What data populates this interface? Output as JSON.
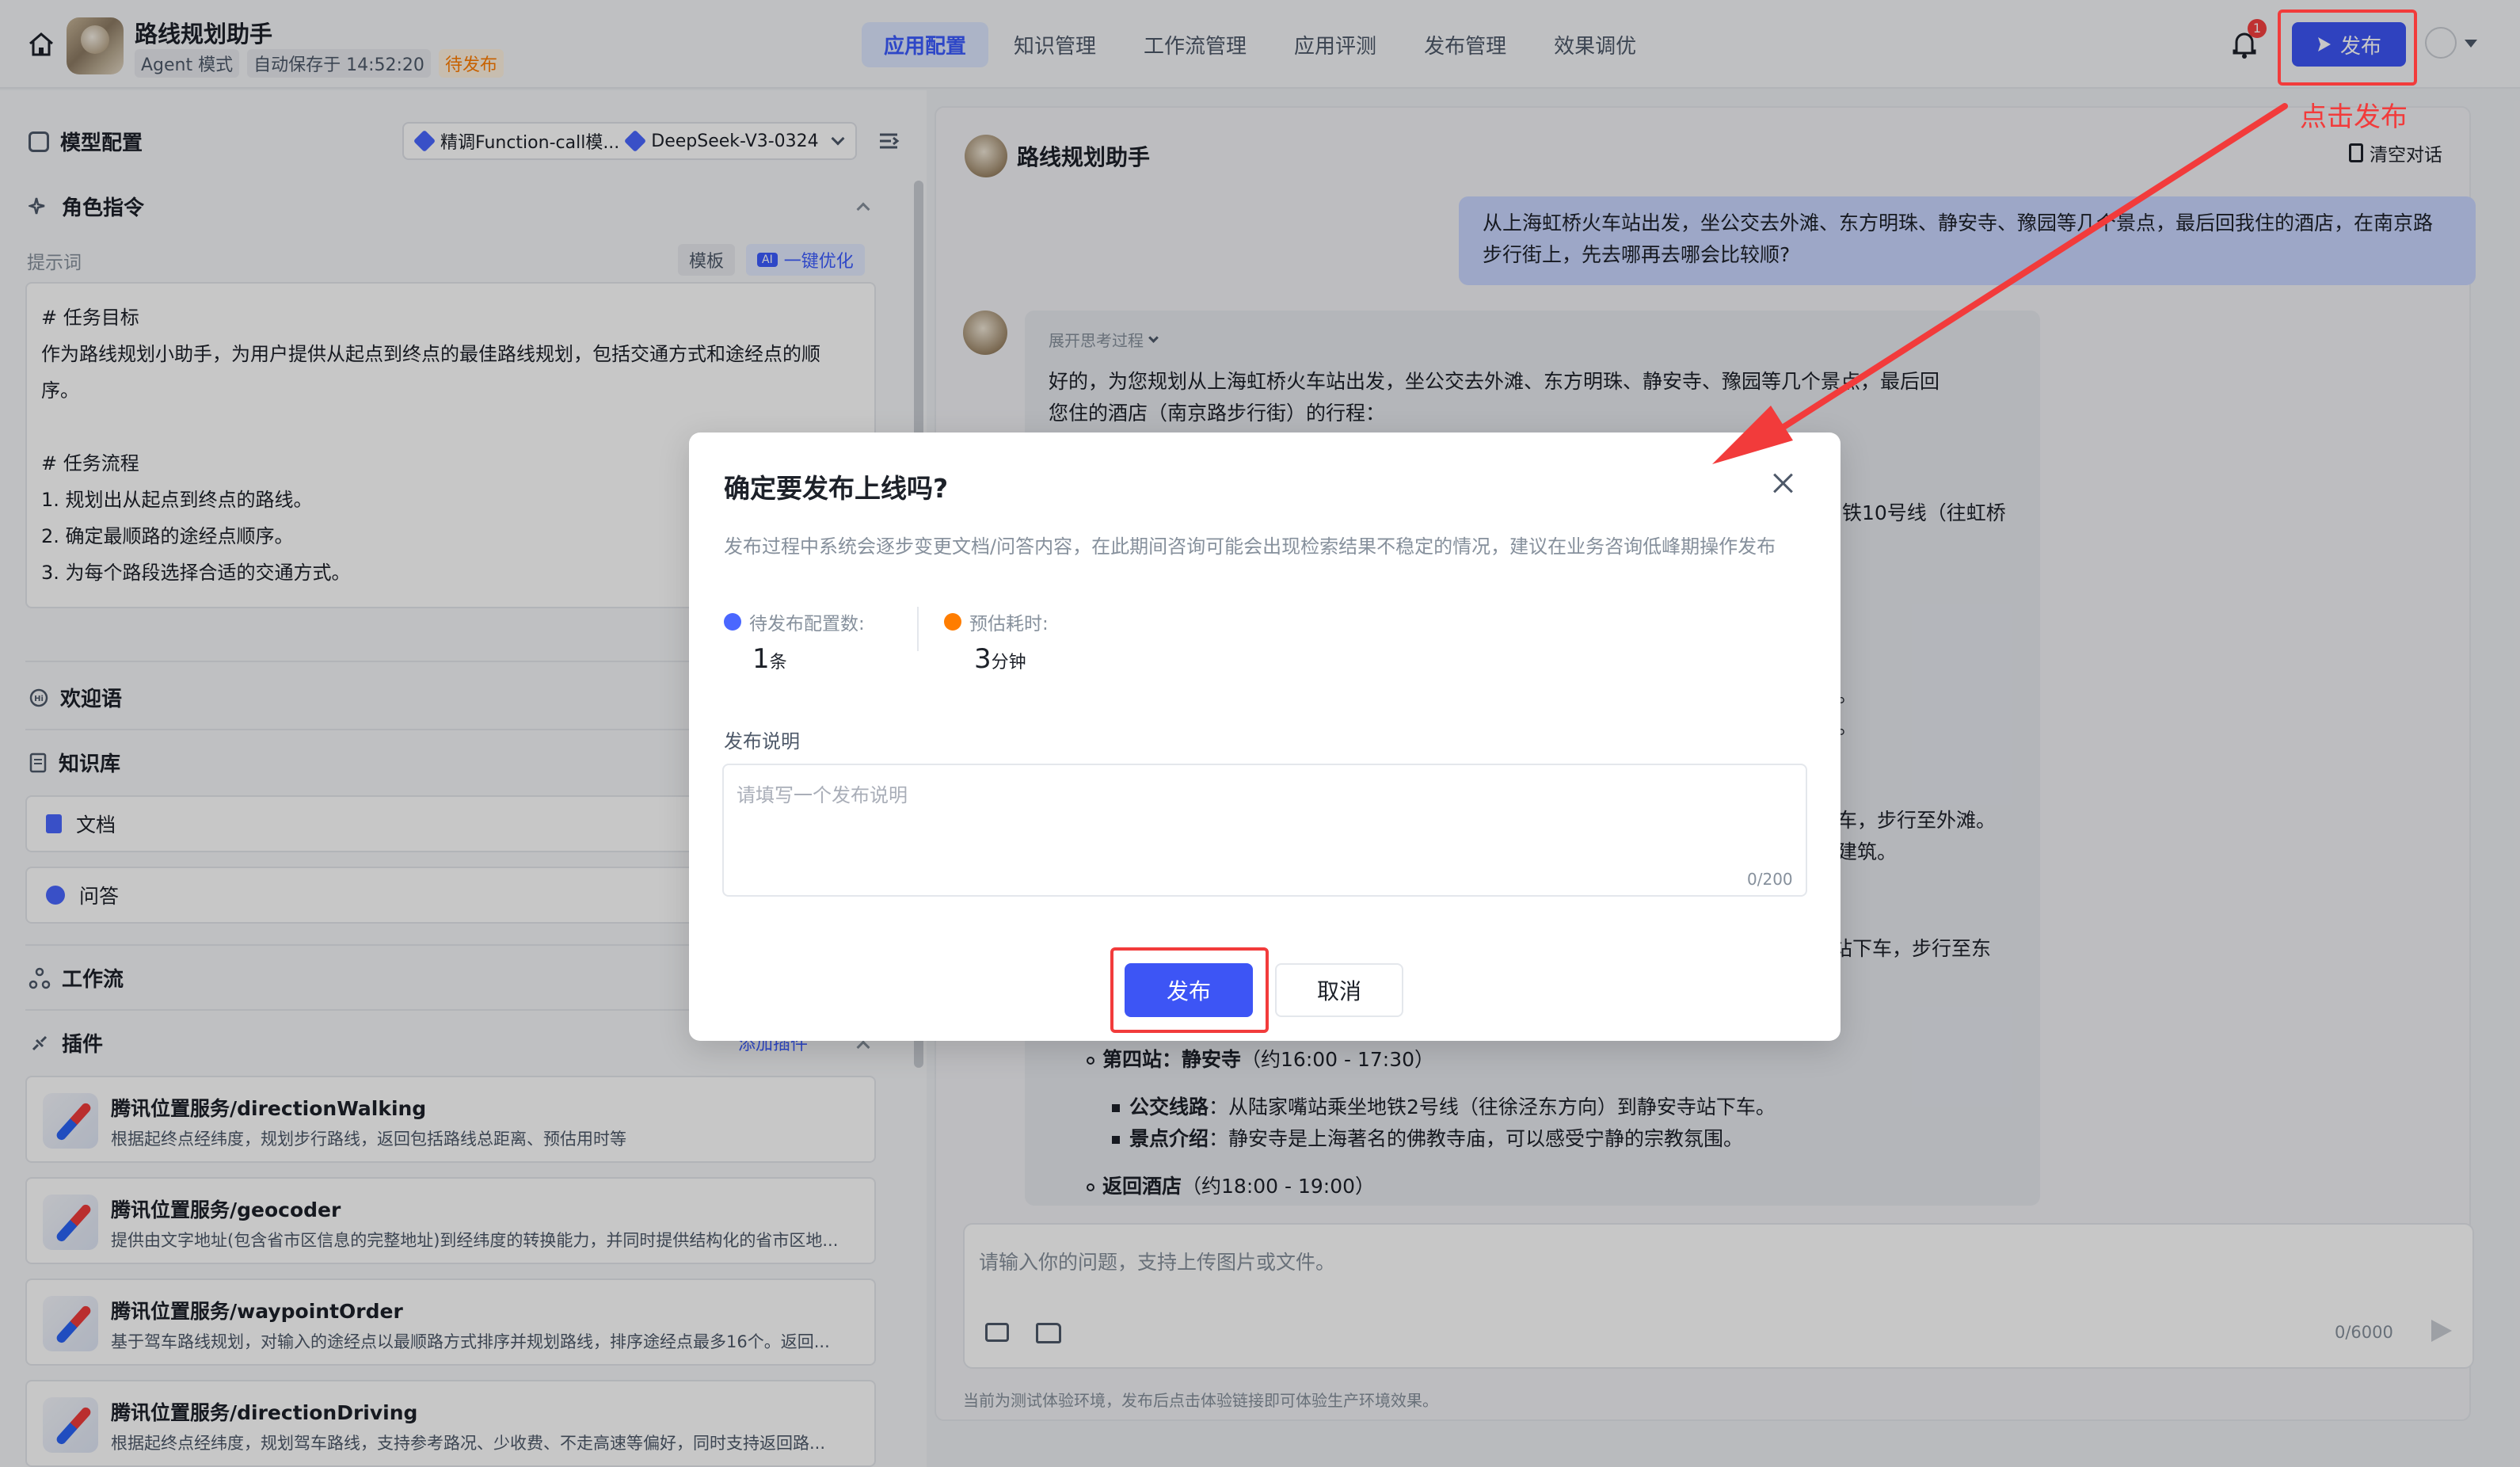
{
  "header": {
    "app_title": "路线规划助手",
    "mode": "Agent 模式",
    "autosave": "自动保存于 14:52:20",
    "status": "待发布",
    "tabs": [
      {
        "label": "应用配置",
        "active": true
      },
      {
        "label": "知识管理"
      },
      {
        "label": "工作流管理"
      },
      {
        "label": "应用评测"
      },
      {
        "label": "发布管理"
      },
      {
        "label": "效果调优"
      }
    ],
    "notification_count": "1",
    "publish_label": "发布"
  },
  "left": {
    "model_section": "模型配置",
    "model_1": "精调Function-call模...",
    "model_2": "DeepSeek-V3-0324",
    "role_section": "角色指令",
    "prompt_label": "提示词",
    "template_btn": "模板",
    "ai_chip": "AI",
    "optimize_btn": "一键优化",
    "prompt_lines": [
      "# 任务目标",
      "作为路线规划小助手，为用户提供从起点到终点的最佳路线规划，包括交通方式和途经点的顺",
      "序。",
      "",
      "# 任务流程",
      "1. 规划出从起点到终点的路线。",
      "2. 确定最顺路的途经点顺序。",
      "3. 为每个路段选择合适的交通方式。"
    ],
    "welcome_section": "欢迎语",
    "kb_section": "知识库",
    "kb_doc": "文档",
    "kb_qa": "问答",
    "workflow_section": "工作流",
    "plugin_section": "插件",
    "add_plugin": "添加插件",
    "plugins": [
      {
        "name": "腾讯位置服务/directionWalking",
        "desc": "根据起终点经纬度，规划步行路线，返回包括路线总距离、预估用时等"
      },
      {
        "name": "腾讯位置服务/geocoder",
        "desc": "提供由文字地址(包含省市区信息的完整地址)到经纬度的转换能力，并同时提供结构化的省市区地..."
      },
      {
        "name": "腾讯位置服务/waypointOrder",
        "desc": "基于驾车路线规划，对输入的途经点以最顺路方式排序并规划路线，排序途经点最多16个。返回..."
      },
      {
        "name": "腾讯位置服务/directionDriving",
        "desc": "根据起终点经纬度，规划驾车路线，支持参考路况、少收费、不走高速等偏好，同时支持返回路..."
      }
    ]
  },
  "chat": {
    "title": "路线规划助手",
    "clear_label": "清空对话",
    "user_message": "从上海虹桥火车站出发，坐公交去外滩、东方明珠、静安寺、豫园等几个景点，最后回我住的酒店，在南京路步行街上，先去哪再去哪会比较顺?",
    "thinking_label": "展开思考过程",
    "bot_intro_1": "好的，为您规划从上海虹桥火车站出发，坐公交去外滩、东方明珠、静安寺、豫园等几个景点，最后回",
    "bot_intro_2": "您住的酒店（南京路步行街）的行程：",
    "bot_frag_1": "铁10号线（往虹桥",
    "bot_frag_2": "。",
    "bot_frag_3": "。",
    "bot_frag_4": "车，步行至外滩。",
    "bot_frag_5": "建筑。",
    "bot_frag_6": "站下车，步行至东",
    "stop4_title": "第四站：静安寺",
    "stop4_time": "（约16:00 - 17:30）",
    "stop4_route_label": "公交线路",
    "stop4_route": "：从陆家嘴站乘坐地铁2号线（往徐泾东方向）到静安寺站下车。",
    "stop4_intro_label": "景点介绍",
    "stop4_intro": "：静安寺是上海著名的佛教寺庙，可以感受宁静的宗教氛围。",
    "return_title": "返回酒店",
    "return_time": "（约18:00 - 19:00）",
    "input_placeholder": "请输入你的问题，支持上传图片或文件。",
    "input_count": "0/6000",
    "footer_note": "当前为测试体验环境，发布后点击体验链接即可体验生产环境效果。"
  },
  "modal": {
    "title": "确定要发布上线吗?",
    "description": "发布过程中系统会逐步变更文档/问答内容，在此期间咨询可能会出现检索结果不稳定的情况，建议在业务咨询低峰期操作发布",
    "pending_label": "待发布配置数:",
    "pending_value": "1",
    "pending_unit": "条",
    "time_label": "预估耗时:",
    "time_value": "3",
    "time_unit": "分钟",
    "note_label": "发布说明",
    "note_placeholder": "请填写一个发布说明",
    "note_count": "0/200",
    "confirm": "发布",
    "cancel": "取消"
  },
  "annotation": {
    "text": "点击发布",
    "color": "#f23b3b"
  }
}
